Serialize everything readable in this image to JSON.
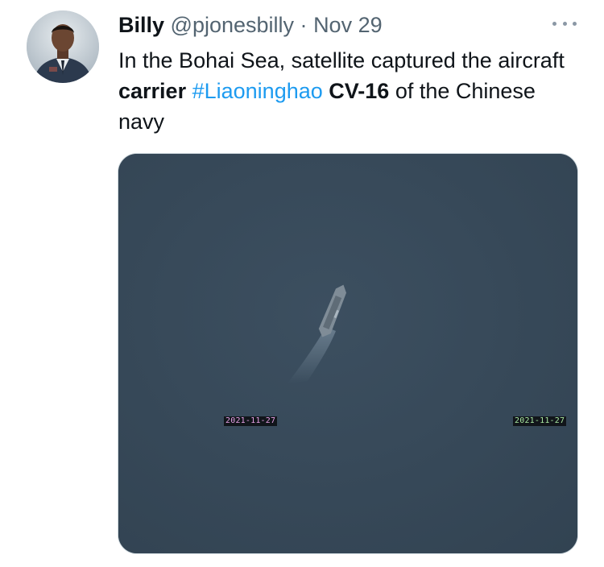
{
  "tweet": {
    "display_name": "Billy",
    "handle": "@pjonesbilly",
    "separator": "·",
    "date": "Nov 29",
    "text": {
      "part1": "In the Bohai Sea, satellite captured the aircraft ",
      "bold1": "carrier",
      "space1": " ",
      "hashtag": "#Liaoninghao",
      "space2": " ",
      "bold2": "CV-16",
      "part2": " of the Chinese navy"
    }
  },
  "media": {
    "stamp_left": "2021-11-27",
    "stamp_right": "2021-11-27"
  },
  "colors": {
    "hashtag": "#1d9bf0",
    "muted": "#536471",
    "sea": "#37495a"
  },
  "icons": [
    "more-options-icon"
  ]
}
